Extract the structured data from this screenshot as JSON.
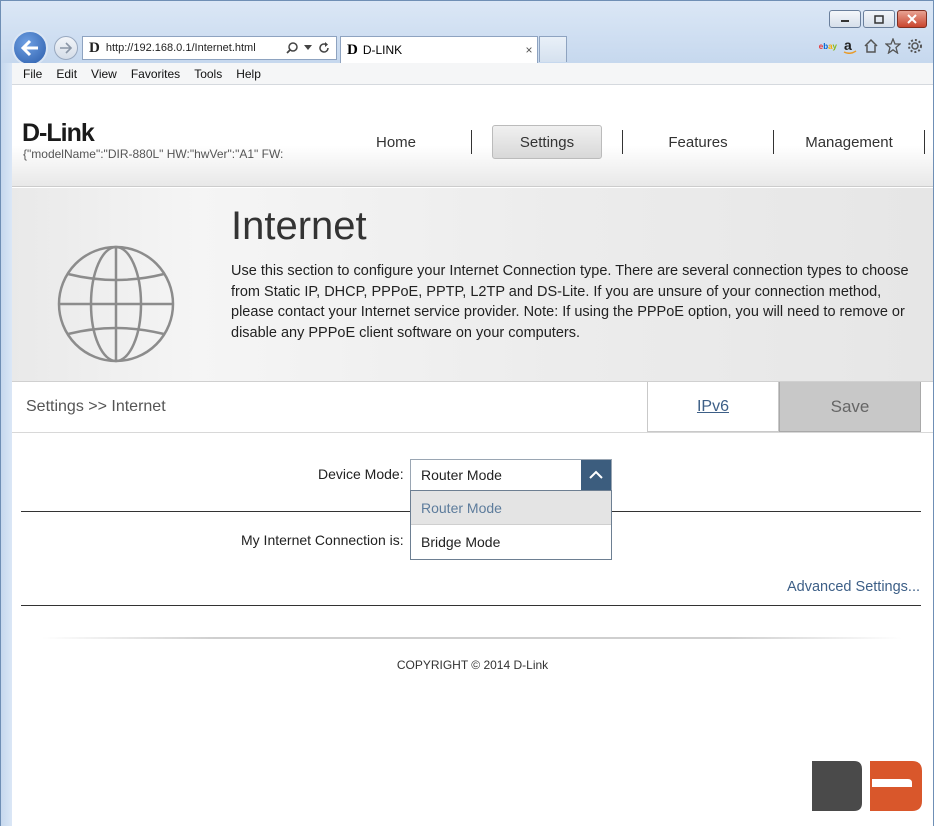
{
  "browser": {
    "address_url": "http://192.168.0.1/Internet.html",
    "tab_title": "D-LINK",
    "tab_close": "×",
    "menu": [
      "File",
      "Edit",
      "View",
      "Favorites",
      "Tools",
      "Help"
    ],
    "toolbar_icons": [
      "ebay-icon",
      "amazon-icon",
      "home-icon",
      "favorites-star-icon",
      "settings-gear-icon"
    ],
    "ebay_letters": [
      "e",
      "b",
      "a",
      "y"
    ]
  },
  "header": {
    "logo_text": "D-Link",
    "model_info": "{\"modelName\":\"DIR-880L\"   HW:\"hwVer\":\"A1\"   FW:",
    "nav": [
      "Home",
      "Settings",
      "Features",
      "Management"
    ],
    "active_nav": "Settings"
  },
  "banner": {
    "title": "Internet",
    "description": "Use this section to configure your Internet Connection type. There are several connection types to choose from Static IP, DHCP, PPPoE, PPTP, L2TP and DS-Lite. If you are unsure of your connection method, please contact your Internet service provider. Note: If using the PPPoE option, you will need to remove or disable any PPPoE client software on your computers."
  },
  "breadcrumb": "Settings >> Internet",
  "buttons": {
    "ipv6": "IPv6",
    "save": "Save"
  },
  "form": {
    "device_mode_label": "Device Mode:",
    "device_mode_value": "Router Mode",
    "device_mode_options": [
      "Router Mode",
      "Bridge Mode"
    ],
    "connection_label": "My Internet Connection is:",
    "advanced_link": "Advanced Settings..."
  },
  "footer": {
    "copyright": "COPYRIGHT © 2014 D-Link"
  },
  "colors": {
    "accent": "#3c5d7e",
    "link": "#3d5f87",
    "save_bg": "#c8c8c8"
  }
}
